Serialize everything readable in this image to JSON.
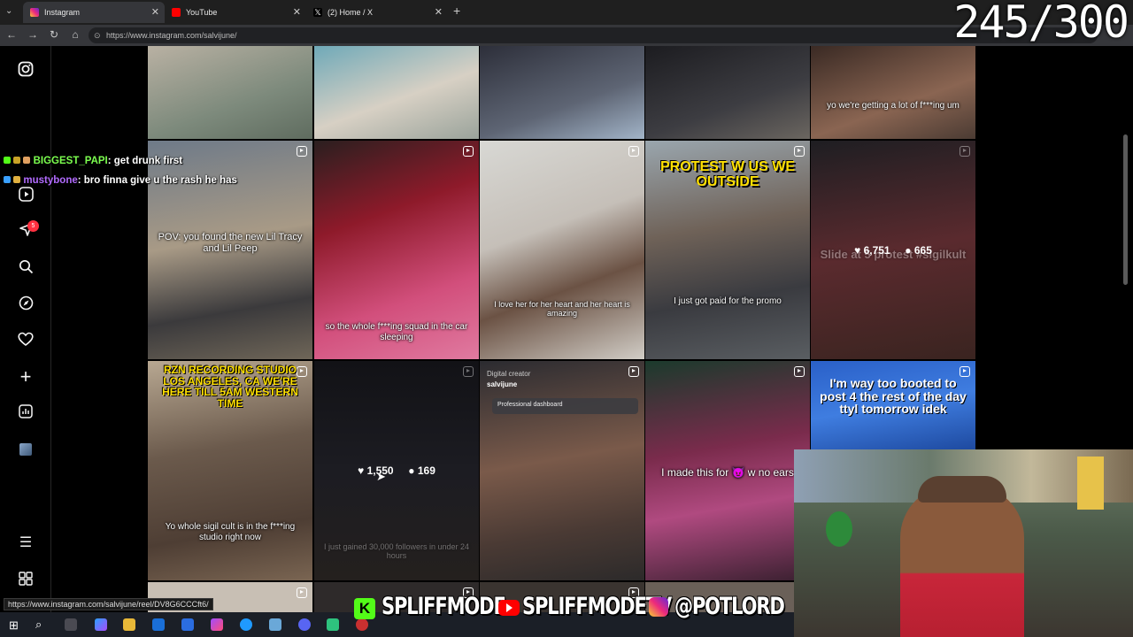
{
  "tabs": [
    {
      "title": "Instagram",
      "active": true
    },
    {
      "title": "YouTube",
      "active": false
    },
    {
      "title": "(2) Home / X",
      "active": false
    }
  ],
  "address": {
    "url": "https://www.instagram.com/salvijune/"
  },
  "counter": "245/300",
  "status_url": "https://www.instagram.com/salvijune/reel/DV8G6CCCft6/",
  "sidenav": {
    "notification_count": "5"
  },
  "chat": [
    {
      "user": "BIGGEST_PAPI",
      "message": ": get drunk first",
      "color": "#7cff4f"
    },
    {
      "user": "mustybone",
      "message": ": bro finna give u the rash he has",
      "color": "#b26bff"
    }
  ],
  "tiles": {
    "r0c4_caption": "yo we're getting a lot of f***ing um",
    "r1c0_caption": "POV: you found the new Lil Tracy and Lil Peep",
    "r1c1_caption": "so the whole f***ing squad in the car sleeping",
    "r1c2_caption": "I love her for her heart and her heart is amazing",
    "r1c3_title": "PROTEST W US WE OUTSIDE",
    "r1c3_caption": "I just got paid for the promo",
    "r1c4_likes": "6,751",
    "r1c4_comments": "665",
    "r1c4_bg_text": "Slide at 5 protest #sigilkult",
    "r2c0_title": "RZN RECORDING STUDIO LOS ANGELES, CA WE'RE HERE TILL 5AM WESTERN TIME",
    "r2c0_caption": "Yo whole sigil cult is in the f***ing studio right now",
    "r2c1_likes": "1,550",
    "r2c1_comments": "169",
    "r2c1_bg_text": "I just gained 30,000 followers in under 24 hours",
    "r2c2_label": "Digital creator",
    "r2c2_handle": "salvijune",
    "r2c2_dashboard": "Professional dashboard",
    "r2c3_caption": "I made this for 😈 w no ears",
    "r2c4_title": "I'm way too booted to post 4 the rest of the day ttyl tomorrow idek"
  },
  "banner": {
    "kick": "SPLIFFMODE",
    "youtube": "SPLIFFMODETV",
    "instagram": "@POTLORD"
  },
  "colors": {
    "accent_red": "#ff3040",
    "chat_green": "#7cff4f",
    "chat_purple": "#b26bff"
  }
}
